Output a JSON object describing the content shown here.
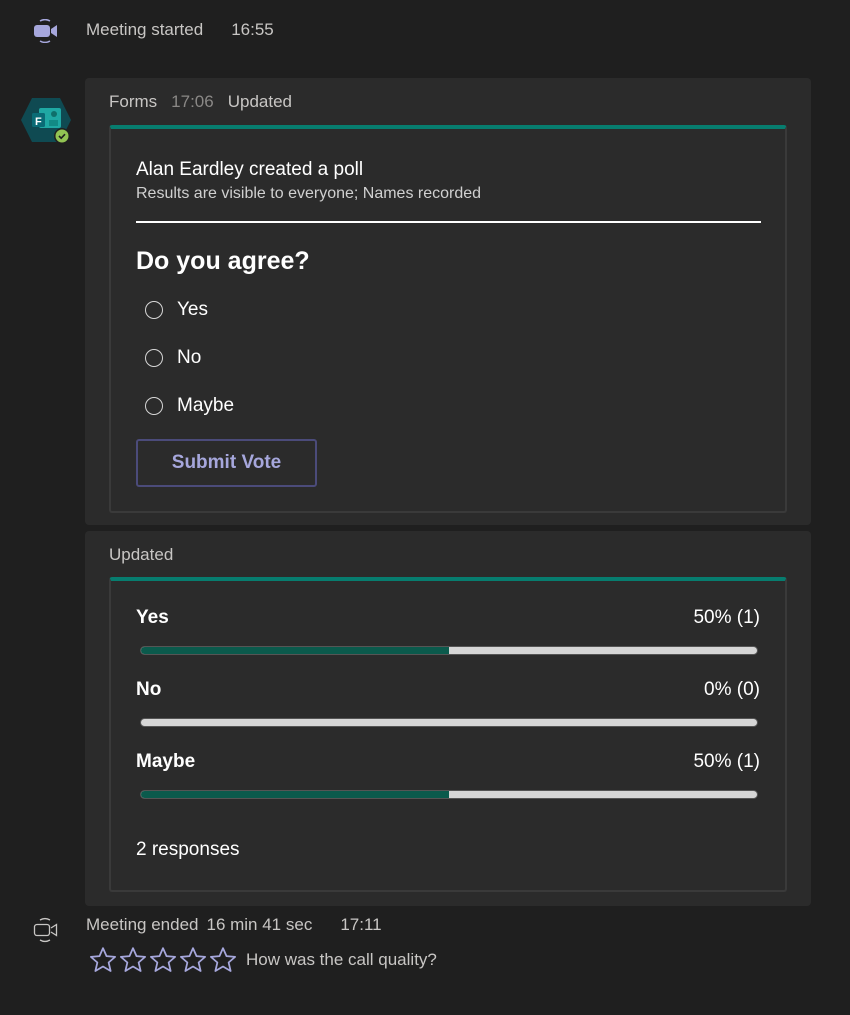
{
  "meeting_started": {
    "icon": "video-camera-icon",
    "label": "Meeting started",
    "time": "16:55"
  },
  "forms_message": {
    "app_name": "Forms",
    "time": "17:06",
    "status": "Updated",
    "avatar_icon": "microsoft-forms-icon",
    "avatar_badge": "verified-check-icon",
    "poll": {
      "creator_line": "Alan Eardley created a poll",
      "subtitle": "Results are visible to everyone; Names recorded",
      "question": "Do you agree?",
      "options": [
        {
          "label": "Yes",
          "selected": false
        },
        {
          "label": "No",
          "selected": false
        },
        {
          "label": "Maybe",
          "selected": false
        }
      ],
      "submit_label": "Submit Vote"
    }
  },
  "results_message": {
    "status": "Updated",
    "results": [
      {
        "label": "Yes",
        "value_text": "50% (1)",
        "percent": 50,
        "count": 1
      },
      {
        "label": "No",
        "value_text": "0% (0)",
        "percent": 0,
        "count": 0
      },
      {
        "label": "Maybe",
        "value_text": "50% (1)",
        "percent": 50,
        "count": 1
      }
    ],
    "responses_text": "2 responses"
  },
  "meeting_ended": {
    "icon": "video-camera-outline-icon",
    "label": "Meeting ended",
    "duration": "16 min 41 sec",
    "time": "17:11",
    "rating_stars": 5,
    "rating_value": 0,
    "rating_question": "How was the call quality?"
  },
  "colors": {
    "background": "#1f1f1f",
    "bubble": "#2b2b2b",
    "accent_teal": "#077d6f",
    "bar_fill": "#0b5a4c",
    "brand_purple": "#a6a7dc"
  }
}
